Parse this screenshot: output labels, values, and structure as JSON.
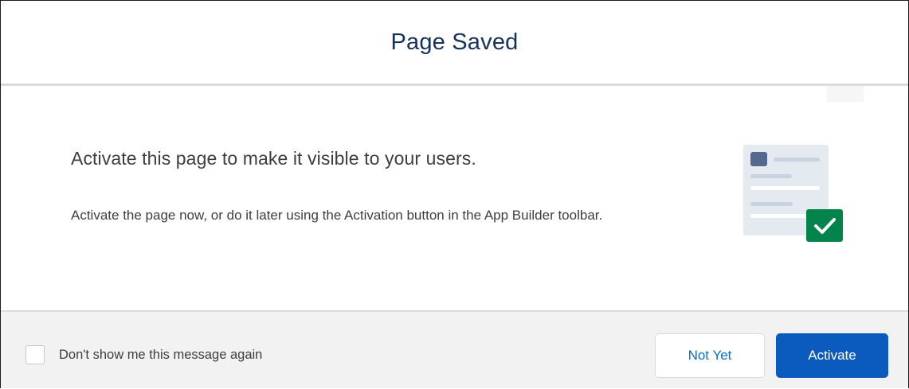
{
  "dialog": {
    "title": "Page Saved",
    "heading": "Activate this page to make it visible to your users.",
    "description": "Activate the page now, or do it later using the Activation button in the App Builder toolbar."
  },
  "illustration": {
    "icon": "page-activated-checkmark-icon",
    "colors": {
      "page": "#e5e9f0",
      "lines": "#c9d2e0",
      "block": "#54698d",
      "check_badge": "#04844b"
    }
  },
  "footer": {
    "checkbox_label": "Don't show me this message again",
    "checkbox_checked": false,
    "not_yet_label": "Not Yet",
    "activate_label": "Activate"
  },
  "colors": {
    "title": "#16325c",
    "brand": "#0a5bbd",
    "link": "#0070d2",
    "footer_bg": "#f3f2f2",
    "divider": "#dddbda"
  }
}
